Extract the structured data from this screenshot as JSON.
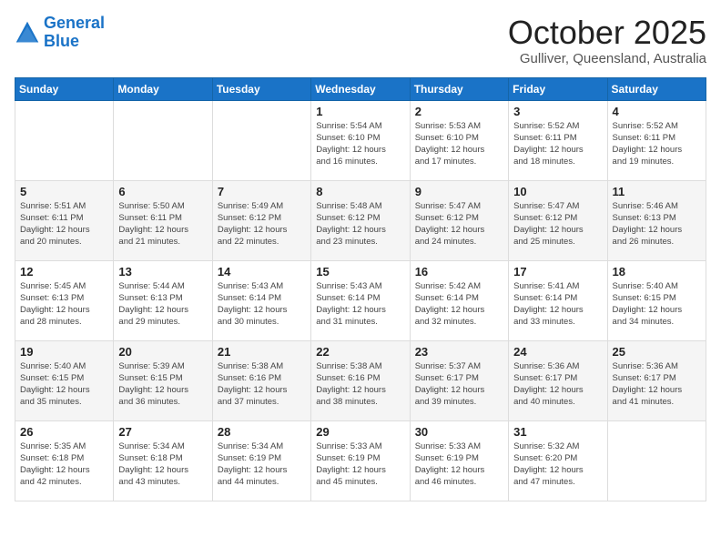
{
  "logo": {
    "line1": "General",
    "line2": "Blue"
  },
  "header": {
    "month": "October 2025",
    "location": "Gulliver, Queensland, Australia"
  },
  "weekdays": [
    "Sunday",
    "Monday",
    "Tuesday",
    "Wednesday",
    "Thursday",
    "Friday",
    "Saturday"
  ],
  "weeks": [
    [
      {
        "day": "",
        "info": ""
      },
      {
        "day": "",
        "info": ""
      },
      {
        "day": "",
        "info": ""
      },
      {
        "day": "1",
        "info": "Sunrise: 5:54 AM\nSunset: 6:10 PM\nDaylight: 12 hours\nand 16 minutes."
      },
      {
        "day": "2",
        "info": "Sunrise: 5:53 AM\nSunset: 6:10 PM\nDaylight: 12 hours\nand 17 minutes."
      },
      {
        "day": "3",
        "info": "Sunrise: 5:52 AM\nSunset: 6:11 PM\nDaylight: 12 hours\nand 18 minutes."
      },
      {
        "day": "4",
        "info": "Sunrise: 5:52 AM\nSunset: 6:11 PM\nDaylight: 12 hours\nand 19 minutes."
      }
    ],
    [
      {
        "day": "5",
        "info": "Sunrise: 5:51 AM\nSunset: 6:11 PM\nDaylight: 12 hours\nand 20 minutes."
      },
      {
        "day": "6",
        "info": "Sunrise: 5:50 AM\nSunset: 6:11 PM\nDaylight: 12 hours\nand 21 minutes."
      },
      {
        "day": "7",
        "info": "Sunrise: 5:49 AM\nSunset: 6:12 PM\nDaylight: 12 hours\nand 22 minutes."
      },
      {
        "day": "8",
        "info": "Sunrise: 5:48 AM\nSunset: 6:12 PM\nDaylight: 12 hours\nand 23 minutes."
      },
      {
        "day": "9",
        "info": "Sunrise: 5:47 AM\nSunset: 6:12 PM\nDaylight: 12 hours\nand 24 minutes."
      },
      {
        "day": "10",
        "info": "Sunrise: 5:47 AM\nSunset: 6:12 PM\nDaylight: 12 hours\nand 25 minutes."
      },
      {
        "day": "11",
        "info": "Sunrise: 5:46 AM\nSunset: 6:13 PM\nDaylight: 12 hours\nand 26 minutes."
      }
    ],
    [
      {
        "day": "12",
        "info": "Sunrise: 5:45 AM\nSunset: 6:13 PM\nDaylight: 12 hours\nand 28 minutes."
      },
      {
        "day": "13",
        "info": "Sunrise: 5:44 AM\nSunset: 6:13 PM\nDaylight: 12 hours\nand 29 minutes."
      },
      {
        "day": "14",
        "info": "Sunrise: 5:43 AM\nSunset: 6:14 PM\nDaylight: 12 hours\nand 30 minutes."
      },
      {
        "day": "15",
        "info": "Sunrise: 5:43 AM\nSunset: 6:14 PM\nDaylight: 12 hours\nand 31 minutes."
      },
      {
        "day": "16",
        "info": "Sunrise: 5:42 AM\nSunset: 6:14 PM\nDaylight: 12 hours\nand 32 minutes."
      },
      {
        "day": "17",
        "info": "Sunrise: 5:41 AM\nSunset: 6:14 PM\nDaylight: 12 hours\nand 33 minutes."
      },
      {
        "day": "18",
        "info": "Sunrise: 5:40 AM\nSunset: 6:15 PM\nDaylight: 12 hours\nand 34 minutes."
      }
    ],
    [
      {
        "day": "19",
        "info": "Sunrise: 5:40 AM\nSunset: 6:15 PM\nDaylight: 12 hours\nand 35 minutes."
      },
      {
        "day": "20",
        "info": "Sunrise: 5:39 AM\nSunset: 6:15 PM\nDaylight: 12 hours\nand 36 minutes."
      },
      {
        "day": "21",
        "info": "Sunrise: 5:38 AM\nSunset: 6:16 PM\nDaylight: 12 hours\nand 37 minutes."
      },
      {
        "day": "22",
        "info": "Sunrise: 5:38 AM\nSunset: 6:16 PM\nDaylight: 12 hours\nand 38 minutes."
      },
      {
        "day": "23",
        "info": "Sunrise: 5:37 AM\nSunset: 6:17 PM\nDaylight: 12 hours\nand 39 minutes."
      },
      {
        "day": "24",
        "info": "Sunrise: 5:36 AM\nSunset: 6:17 PM\nDaylight: 12 hours\nand 40 minutes."
      },
      {
        "day": "25",
        "info": "Sunrise: 5:36 AM\nSunset: 6:17 PM\nDaylight: 12 hours\nand 41 minutes."
      }
    ],
    [
      {
        "day": "26",
        "info": "Sunrise: 5:35 AM\nSunset: 6:18 PM\nDaylight: 12 hours\nand 42 minutes."
      },
      {
        "day": "27",
        "info": "Sunrise: 5:34 AM\nSunset: 6:18 PM\nDaylight: 12 hours\nand 43 minutes."
      },
      {
        "day": "28",
        "info": "Sunrise: 5:34 AM\nSunset: 6:19 PM\nDaylight: 12 hours\nand 44 minutes."
      },
      {
        "day": "29",
        "info": "Sunrise: 5:33 AM\nSunset: 6:19 PM\nDaylight: 12 hours\nand 45 minutes."
      },
      {
        "day": "30",
        "info": "Sunrise: 5:33 AM\nSunset: 6:19 PM\nDaylight: 12 hours\nand 46 minutes."
      },
      {
        "day": "31",
        "info": "Sunrise: 5:32 AM\nSunset: 6:20 PM\nDaylight: 12 hours\nand 47 minutes."
      },
      {
        "day": "",
        "info": ""
      }
    ]
  ]
}
